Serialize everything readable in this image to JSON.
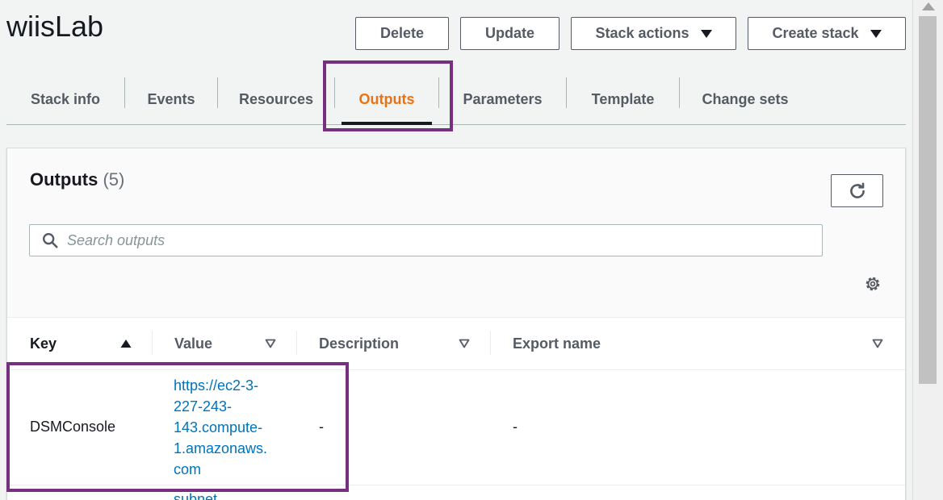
{
  "page": {
    "title": "wiisLab"
  },
  "toolbar": {
    "delete_label": "Delete",
    "update_label": "Update",
    "stack_actions_label": "Stack actions",
    "create_stack_label": "Create stack"
  },
  "tabs": [
    {
      "label": "Stack info"
    },
    {
      "label": "Events"
    },
    {
      "label": "Resources"
    },
    {
      "label": "Outputs",
      "active": true
    },
    {
      "label": "Parameters"
    },
    {
      "label": "Template"
    },
    {
      "label": "Change sets"
    }
  ],
  "outputs": {
    "title": "Outputs",
    "count": "(5)",
    "search_placeholder": "Search outputs",
    "columns": {
      "key": "Key",
      "value": "Value",
      "description": "Description",
      "export_name": "Export name"
    },
    "rows": [
      {
        "key": "DSMConsole",
        "value_lines": [
          "https://ec2-3-",
          "227-243-",
          "143.compute-",
          "1.amazonaws.",
          "com"
        ],
        "description": "-",
        "export_name": "-"
      },
      {
        "value_partial": "subnet"
      }
    ]
  },
  "colors": {
    "accent": "#ec7211",
    "highlight": "#76307f",
    "link": "#0073bb"
  },
  "icons": [
    "caret-down-icon",
    "refresh-icon",
    "search-icon",
    "gear-icon",
    "sort-ascending-icon",
    "sort-descending-icon"
  ]
}
